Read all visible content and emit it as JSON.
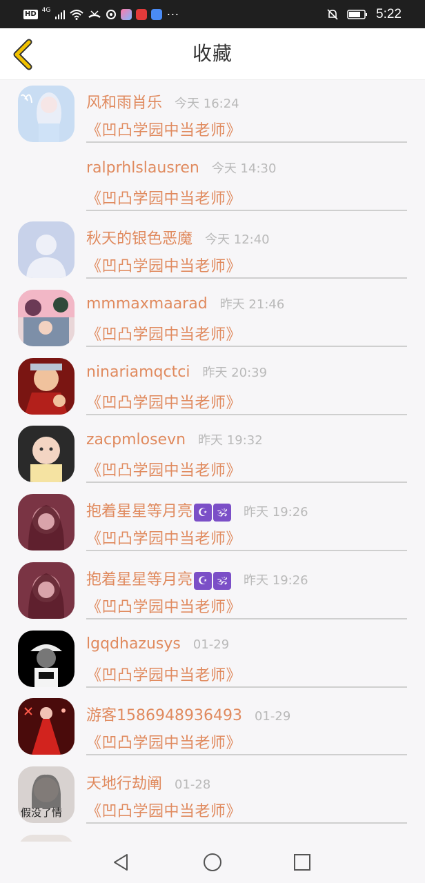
{
  "status_bar": {
    "network_badge": "HD",
    "network_type": "4G",
    "clock": "5:22",
    "icons": [
      "hd-icon",
      "signal-icon",
      "wifi-icon",
      "missed-call-icon",
      "vpn-icon",
      "app-icon",
      "app-icon",
      "music-app-icon",
      "more-icon",
      "mute-bell-icon",
      "battery-icon"
    ]
  },
  "header": {
    "title": "收藏",
    "back_icon": "chevron-left-icon"
  },
  "items": [
    {
      "name": "风和雨肖乐",
      "time": "今天 16:24",
      "title": "《凹凸学园中当老师》",
      "avatar": "anime-girl-deer",
      "emoji": ""
    },
    {
      "name": "ralprhlslausren",
      "time": "今天 14:30",
      "title": "《凹凸学园中当老师》",
      "avatar": "none",
      "emoji": ""
    },
    {
      "name": "秋天的银色恶魔",
      "time": "今天 12:40",
      "title": "《凹凸学园中当老师》",
      "avatar": "default-person",
      "emoji": ""
    },
    {
      "name": "mmmaxmaarad",
      "time": "昨天 21:46",
      "title": "《凹凸学园中当老师》",
      "avatar": "anime-group",
      "emoji": ""
    },
    {
      "name": "ninariamqctci",
      "time": "昨天 20:39",
      "title": "《凹凸学园中当老师》",
      "avatar": "ninja-red",
      "emoji": ""
    },
    {
      "name": "zacpmlosevn",
      "time": "昨天 19:32",
      "title": "《凹凸学园中当老师》",
      "avatar": "baby-photo",
      "emoji": ""
    },
    {
      "name": "抱着星星等月亮",
      "time": "昨天 19:26",
      "title": "《凹凸学园中当老师》",
      "avatar": "dark-girl",
      "emoji": "☪🕉"
    },
    {
      "name": "抱着星星等月亮",
      "time": "昨天 19:26",
      "title": "《凹凸学园中当老师》",
      "avatar": "dark-girl",
      "emoji": "☪🕉"
    },
    {
      "name": "lgqdhazusys",
      "time": "01-29",
      "title": "《凹凸学园中当老师》",
      "avatar": "bw-cap",
      "emoji": ""
    },
    {
      "name": "游客1586948936493",
      "time": "01-29",
      "title": "《凹凸学园中当老师》",
      "avatar": "red-dress",
      "emoji": ""
    },
    {
      "name": "天地行劫阐",
      "time": "01-28",
      "title": "《凹凸学园中当老师》",
      "avatar": "girl-caption",
      "emoji": "",
      "avatar_caption": "假没了情"
    }
  ],
  "nav": {
    "back": "nav-back-icon",
    "home": "nav-home-icon",
    "recents": "nav-recents-icon"
  },
  "colors": {
    "accent": "#e08a5e",
    "back_arrow": "#f2c200",
    "time_gray": "#b9b9b9",
    "divider": "#cfcfcf",
    "status_bar": "#1f1f1f"
  }
}
